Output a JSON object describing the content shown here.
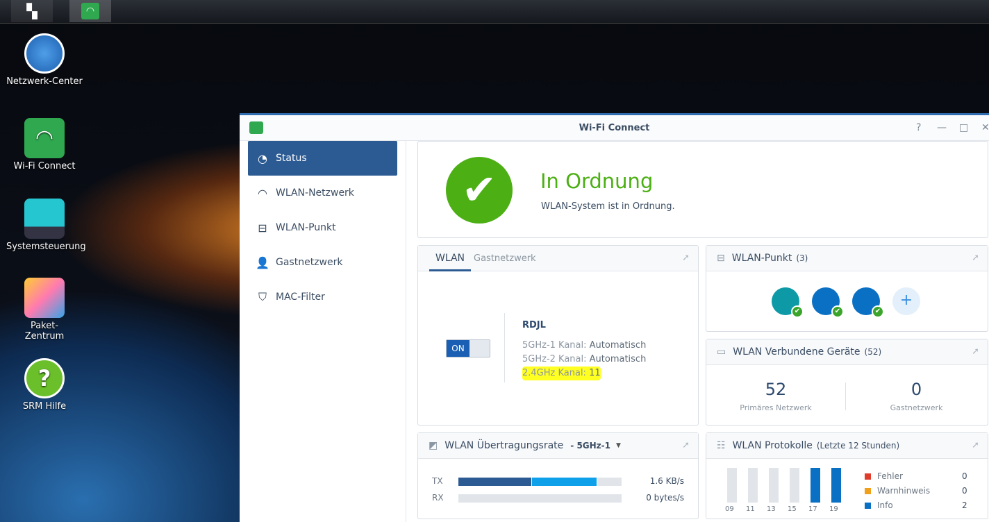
{
  "taskbar": {
    "icons": [
      "apps-grid-icon",
      "wifi-connect-icon"
    ]
  },
  "desktop": [
    {
      "label": "Netzwerk-Center"
    },
    {
      "label": "Wi-Fi Connect"
    },
    {
      "label": "Systemsteuerung"
    },
    {
      "label": "Paket-\nZentrum"
    },
    {
      "label": "SRM Hilfe"
    }
  ],
  "window": {
    "title": "Wi-Fi Connect",
    "controls": [
      "?",
      "—",
      "□",
      "✕"
    ]
  },
  "sidebar": [
    {
      "label": "Status",
      "icon": "gauge-icon"
    },
    {
      "label": "WLAN-Netzwerk",
      "icon": "wifi-icon"
    },
    {
      "label": "WLAN-Punkt",
      "icon": "access-point-icon"
    },
    {
      "label": "Gastnetzwerk",
      "icon": "guest-icon"
    },
    {
      "label": "MAC-Filter",
      "icon": "shield-wifi-icon"
    }
  ],
  "status": {
    "title": "In Ordnung",
    "message": "WLAN-System ist in Ordnung.",
    "color": "#4caf14"
  },
  "wlan": {
    "tabs": [
      "WLAN",
      "Gastnetzwerk"
    ],
    "toggle": "ON",
    "ssid": "RDJL",
    "rows": [
      {
        "label": "5GHz-1 Kanal:",
        "value": "Automatisch"
      },
      {
        "label": "5GHz-2 Kanal:",
        "value": "Automatisch"
      },
      {
        "label": "2.4GHz Kanal:",
        "value": "11"
      }
    ]
  },
  "ap": {
    "title": "WLAN-Punkt",
    "count": "(3)",
    "add": "+"
  },
  "devices": {
    "title": "WLAN Verbundene Geräte",
    "count": "(52)",
    "primary_value": "52",
    "primary_label": "Primäres Netzwerk",
    "guest_value": "0",
    "guest_label": "Gastnetzwerk"
  },
  "rate": {
    "title": "WLAN Übertragungsrate",
    "band": "- 5GHz-1",
    "tx_label": "TX",
    "tx_value": "1.6 KB/s",
    "rx_label": "RX",
    "rx_value": "0 bytes/s",
    "tx_fill": [
      0.45,
      0.4
    ]
  },
  "logs": {
    "title": "WLAN Protokolle",
    "sub": "(Letzte 12 Stunden)",
    "hours": [
      "09",
      "11",
      "13",
      "15",
      "17",
      "19"
    ],
    "info_counts": [
      0,
      0,
      0,
      0,
      1,
      1
    ],
    "legend": [
      {
        "label": "Fehler",
        "value": "0",
        "color": "#e03c2c"
      },
      {
        "label": "Warnhinweis",
        "value": "0",
        "color": "#f0a01a"
      },
      {
        "label": "Info",
        "value": "2",
        "color": "#0a70c4"
      }
    ]
  }
}
